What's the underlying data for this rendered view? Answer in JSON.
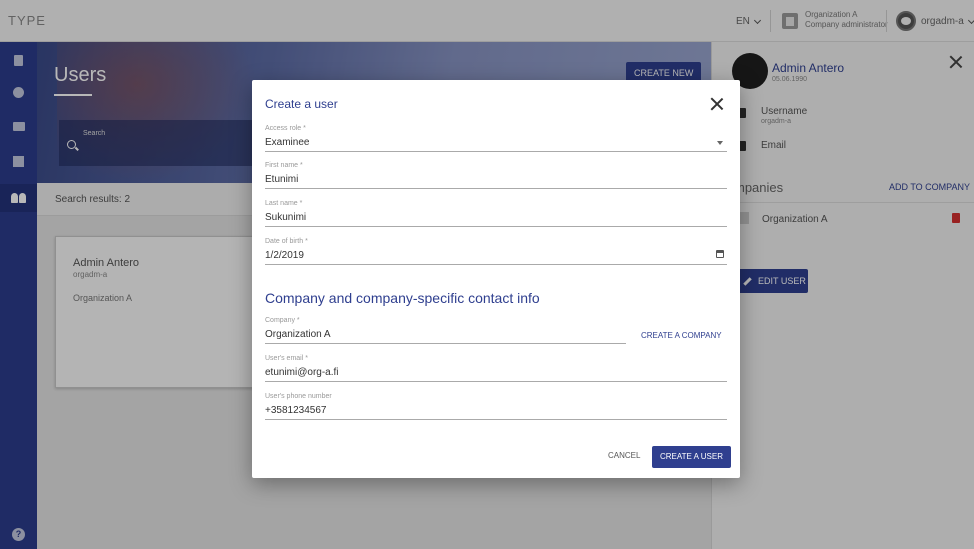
{
  "topbar": {
    "brand": "TYPE",
    "language": "EN",
    "org_name": "Organization A",
    "org_role": "Company administrator",
    "username": "orgadm-a"
  },
  "sidebar": {
    "items": [
      {
        "icon": "book-icon"
      },
      {
        "icon": "check-circle-icon"
      },
      {
        "icon": "briefcase-icon"
      },
      {
        "icon": "building-icon"
      },
      {
        "icon": "people-icon",
        "active": true
      }
    ],
    "help_icon": "help-icon"
  },
  "main": {
    "title": "Users",
    "create_new_label": "Create new",
    "search_label": "Search",
    "results_text": "Search results: 2",
    "card": {
      "name": "Admin Antero",
      "username": "orgadm-a",
      "organization": "Organization A"
    }
  },
  "right_panel": {
    "name": "Admin Antero",
    "date": "05.06.1990",
    "username_label": "Username",
    "username_value": "orgadm-a",
    "email_label": "Email",
    "companies_label": "mpanies",
    "add_to_company_label": "Add to company",
    "company": "Organization A",
    "edit_user_label": "Edit user"
  },
  "dialog": {
    "title": "Create a user",
    "access_role": {
      "label": "Access role *",
      "value": "Examinee"
    },
    "first_name": {
      "label": "First name *",
      "value": "Etunimi"
    },
    "last_name": {
      "label": "Last name *",
      "value": "Sukunimi"
    },
    "date_of_birth": {
      "label": "Date of birth *",
      "value": "1/2/2019"
    },
    "section_title": "Company and company-specific contact info",
    "company": {
      "label": "Company *",
      "value": "Organization A"
    },
    "create_company_label": "Create a company",
    "email": {
      "label": "User's email *",
      "value": "etunimi@org-a.fi"
    },
    "phone": {
      "label": "User's phone number",
      "value": "+3581234567"
    },
    "cancel_label": "Cancel",
    "create_user_label": "Create a user"
  },
  "colors": {
    "primary": "#2f3f8f",
    "sidebar": "#2b3c8c",
    "danger": "#d32f2f"
  }
}
